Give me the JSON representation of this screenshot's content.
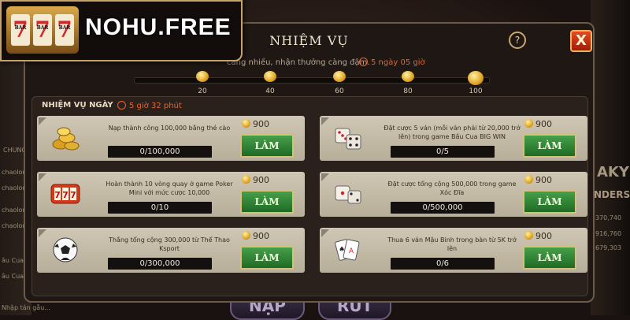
{
  "logo": {
    "text": "NOHU.FREE",
    "reel_digit": "7",
    "reel_bar": "BAR"
  },
  "dialog": {
    "title": "NHIỆM VỤ",
    "help_label": "?",
    "close_label": "X",
    "subtitle": "càng nhiều, nhận thưởng càng đậm.",
    "timer": "5 ngày 05 giờ"
  },
  "milestones": [
    "20",
    "40",
    "60",
    "80",
    "100"
  ],
  "daily": {
    "title": "NHIỆM VỤ NGÀY",
    "timer": "5 giờ 32 phút"
  },
  "quests": [
    {
      "icon": "gold-coins-icon",
      "desc": "Nạp thành công 100,000 bằng thẻ cào",
      "progress": "0/100,000",
      "reward": "900",
      "button": "LÀM"
    },
    {
      "icon": "dice-icon",
      "desc": "Đặt cược 5 ván (mỗi ván phải từ 20,000 trở lên) trong game Bầu Cua BIG WIN",
      "progress": "0/5",
      "reward": "900",
      "button": "LÀM"
    },
    {
      "icon": "slot-777-icon",
      "desc": "Hoàn thành 10 vòng quay ở game Poker Mini với mức cược 10,000",
      "progress": "0/10",
      "reward": "900",
      "button": "LÀM"
    },
    {
      "icon": "dice-icon",
      "desc": "Đặt cược tổng cộng 500,000 trong game Xóc Đĩa",
      "progress": "0/500,000",
      "reward": "900",
      "button": "LÀM"
    },
    {
      "icon": "soccer-ball-icon",
      "desc": "Thắng tổng cộng 300,000 từ Thể Thao Ksport",
      "progress": "0/300,000",
      "reward": "900",
      "button": "LÀM"
    },
    {
      "icon": "playing-cards-icon",
      "desc": "Thua 6 ván Mậu Binh trong bàn từ 5K trở lên",
      "progress": "0/6",
      "reward": "900",
      "button": "LÀM"
    }
  ],
  "background": {
    "left_items": [
      "CHUNG",
      "chaolon",
      "chaolon",
      "chaolon",
      "chaolon",
      "âu Cua",
      "âu Cua",
      "Nhập tán gẫu..."
    ],
    "right_items": [
      "AKY",
      "NDERS",
      "370,740",
      "916,760",
      "679,303"
    ],
    "bottom_buttons": [
      "NẠP",
      "RÚT"
    ]
  }
}
